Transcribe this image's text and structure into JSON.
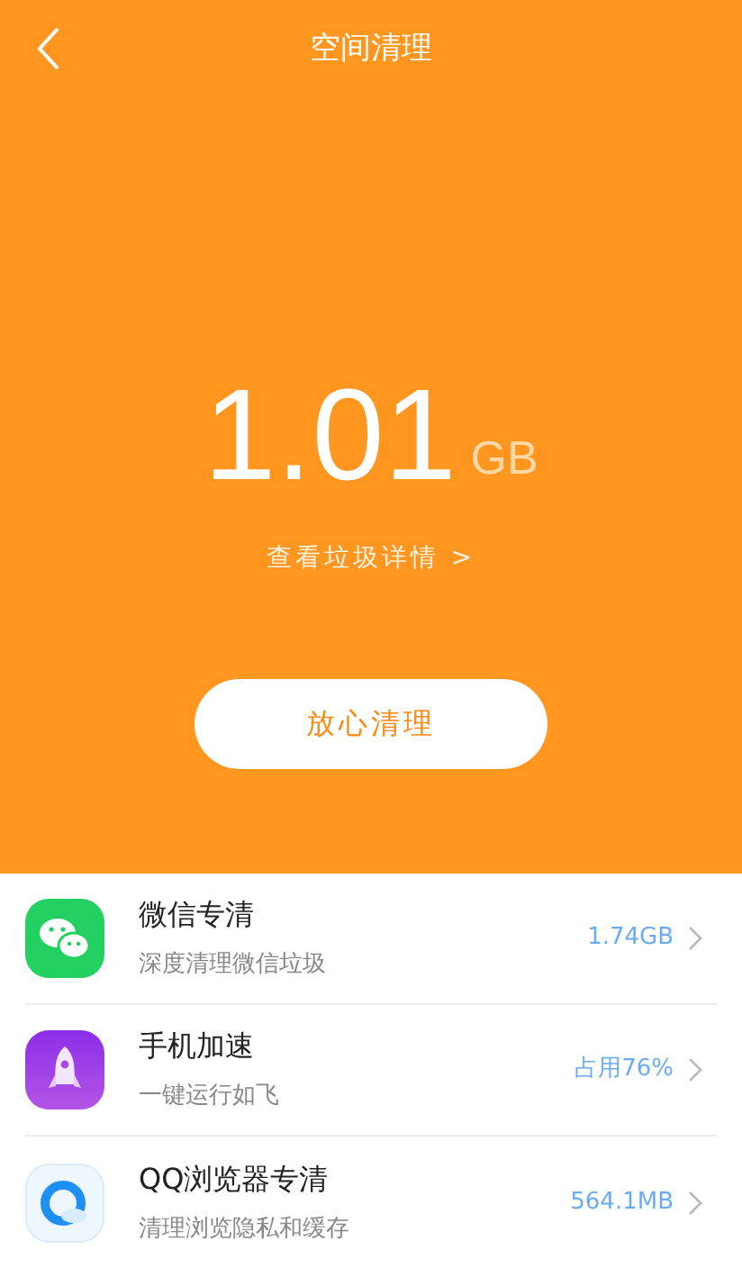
{
  "header": {
    "title": "空间清理"
  },
  "summary": {
    "amount": "1.01",
    "unit": "GB",
    "details_link": "查看垃圾详情 >",
    "clean_button": "放心清理"
  },
  "items": [
    {
      "kind": "chat",
      "title": "微信专清",
      "subtitle": "深度清理微信垃圾",
      "value": "1.74GB"
    },
    {
      "kind": "rocket",
      "title": "手机加速",
      "subtitle": "一键运行如飞",
      "value": "占用76%"
    },
    {
      "kind": "browser",
      "title": "QQ浏览器专清",
      "subtitle": "清理浏览隐私和缓存",
      "value": "564.1MB"
    }
  ]
}
